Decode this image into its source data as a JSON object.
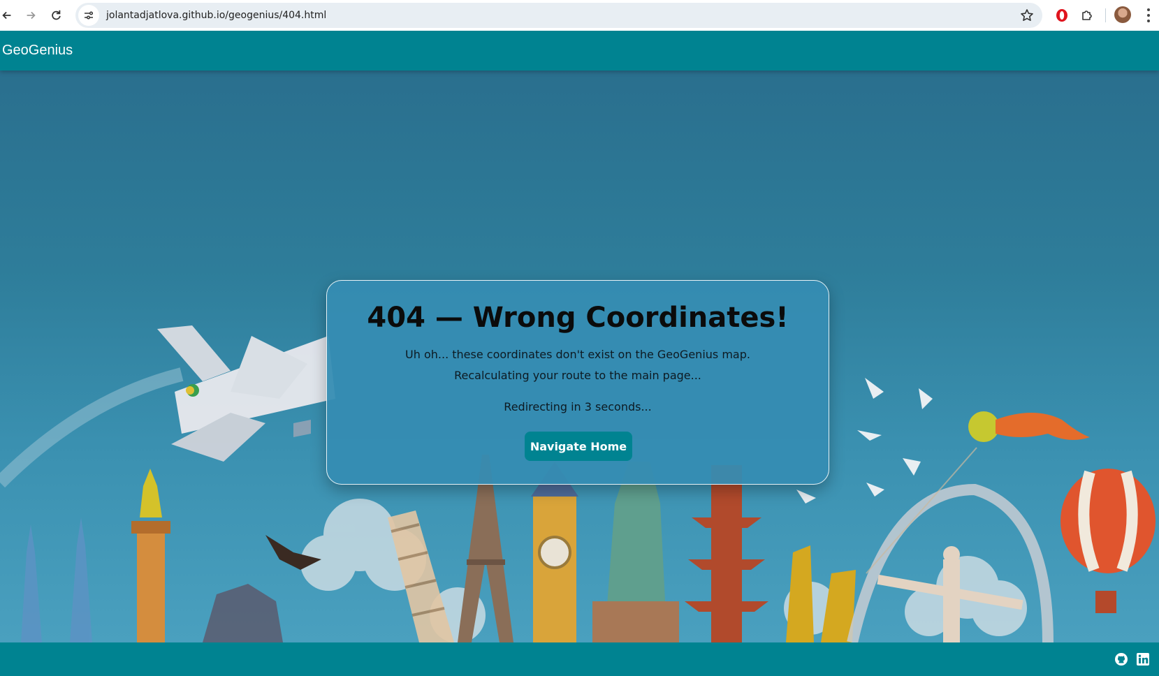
{
  "browser": {
    "url": "jolantadjatlova.github.io/geogenius/404.html",
    "icons": {
      "back": "back-arrow-icon",
      "forward": "forward-arrow-icon",
      "reload": "reload-icon",
      "site_info": "site-settings-icon",
      "bookmark": "star-icon",
      "opera": "opera-icon",
      "extensions": "puzzle-icon",
      "profile": "avatar",
      "menu": "kebab-menu-icon"
    }
  },
  "navbar": {
    "brand": "GeoGenius"
  },
  "card": {
    "title": "404 — Wrong Coordinates!",
    "line1": "Uh oh... these coordinates don't exist on the GeoGenius map.",
    "line2": "Recalculating your route to the main page...",
    "redirect": "Redirecting in 3 seconds...",
    "button": "Navigate Home"
  },
  "footer": {
    "icons": [
      "github-icon",
      "linkedin-icon"
    ]
  },
  "colors": {
    "brand": "#008391",
    "card": "#358cb2",
    "background": "#2e7d9a"
  }
}
